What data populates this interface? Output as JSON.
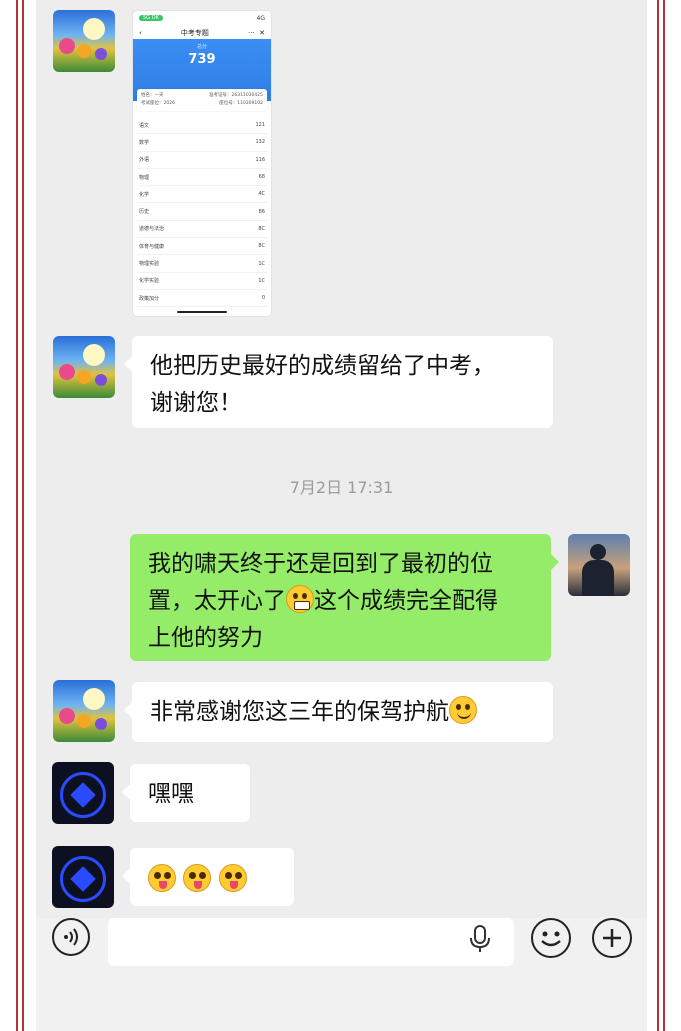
{
  "score_screenshot": {
    "status_badge": "5G OK",
    "signal": "4G",
    "nav_title": "中考专题",
    "nav_more": "···",
    "nav_close": "✕",
    "total_caption": "总分",
    "total_score": "739",
    "info": {
      "name_label": "姓名：",
      "name_value": "一天",
      "exam_id_label": "准考证号：",
      "exam_id_value": "26311030425",
      "seat_label": "考试座位：",
      "seat_value": "2026",
      "room_label": "座位号：",
      "room_value": "110309102"
    },
    "subjects": [
      {
        "name": "语文",
        "score": "121"
      },
      {
        "name": "数学",
        "score": "132"
      },
      {
        "name": "外语",
        "score": "116"
      },
      {
        "name": "物理",
        "score": "68"
      },
      {
        "name": "化学",
        "score": "4C"
      },
      {
        "name": "历史",
        "score": "86"
      },
      {
        "name": "道德与法治",
        "score": "8C"
      },
      {
        "name": "体育与健康",
        "score": "8C"
      },
      {
        "name": "物理实验",
        "score": "1C"
      },
      {
        "name": "化学实验",
        "score": "1C"
      },
      {
        "name": "政策加分",
        "score": "0"
      }
    ]
  },
  "messages": {
    "m1_line1": "他把历史最好的成绩留给了中考，",
    "m1_line2": "谢谢您！",
    "timestamp": "7月2日 17:31",
    "m2_line1": "我的啸天终于还是回到了最初的位",
    "m2_line2a": "置，太开心了",
    "m2_line2b": "这个成绩完全配得",
    "m2_line3": "上他的努力",
    "m3": "非常感谢您这三年的保驾护航",
    "m4": "嘿嘿"
  },
  "icons": {
    "voice": "voice-icon",
    "mic": "microphone-icon",
    "emoji": "emoji-icon",
    "plus": "plus-icon"
  },
  "colors": {
    "bubble_green": "#95ec69",
    "chat_background": "#ededed",
    "border_red": "#b5323a"
  }
}
